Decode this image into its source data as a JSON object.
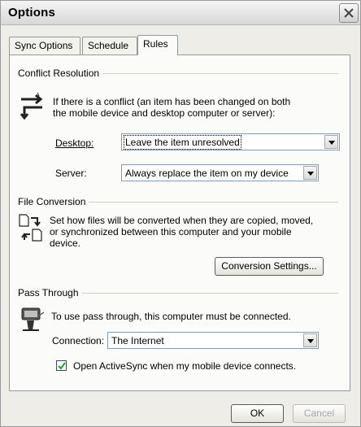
{
  "window": {
    "title": "Options"
  },
  "tabs": [
    {
      "label": "Sync Options"
    },
    {
      "label": "Schedule"
    },
    {
      "label": "Rules"
    }
  ],
  "conflict": {
    "group_title": "Conflict Resolution",
    "description_line1": "If there is a conflict (an item has been changed on both",
    "description_line2": "the mobile device and desktop computer or server):",
    "desktop_label": "Desktop:",
    "desktop_value": "Leave the item unresolved",
    "server_label": "Server:",
    "server_value": "Always replace the item on my device"
  },
  "file_conversion": {
    "group_title": "File Conversion",
    "description_line1": "Set how files will be converted when they are copied, moved,",
    "description_line2": "or synchronized between this computer and your mobile",
    "description_line3": "device.",
    "settings_button": "Conversion Settings..."
  },
  "pass_through": {
    "group_title": "Pass Through",
    "description": "To use pass through, this computer must be connected.",
    "connection_label": "Connection:",
    "connection_value": "The Internet",
    "checkbox_label": "Open ActiveSync when my mobile device connects.",
    "checkbox_checked": true
  },
  "footer": {
    "ok_label": "OK",
    "cancel_label": "Cancel"
  }
}
